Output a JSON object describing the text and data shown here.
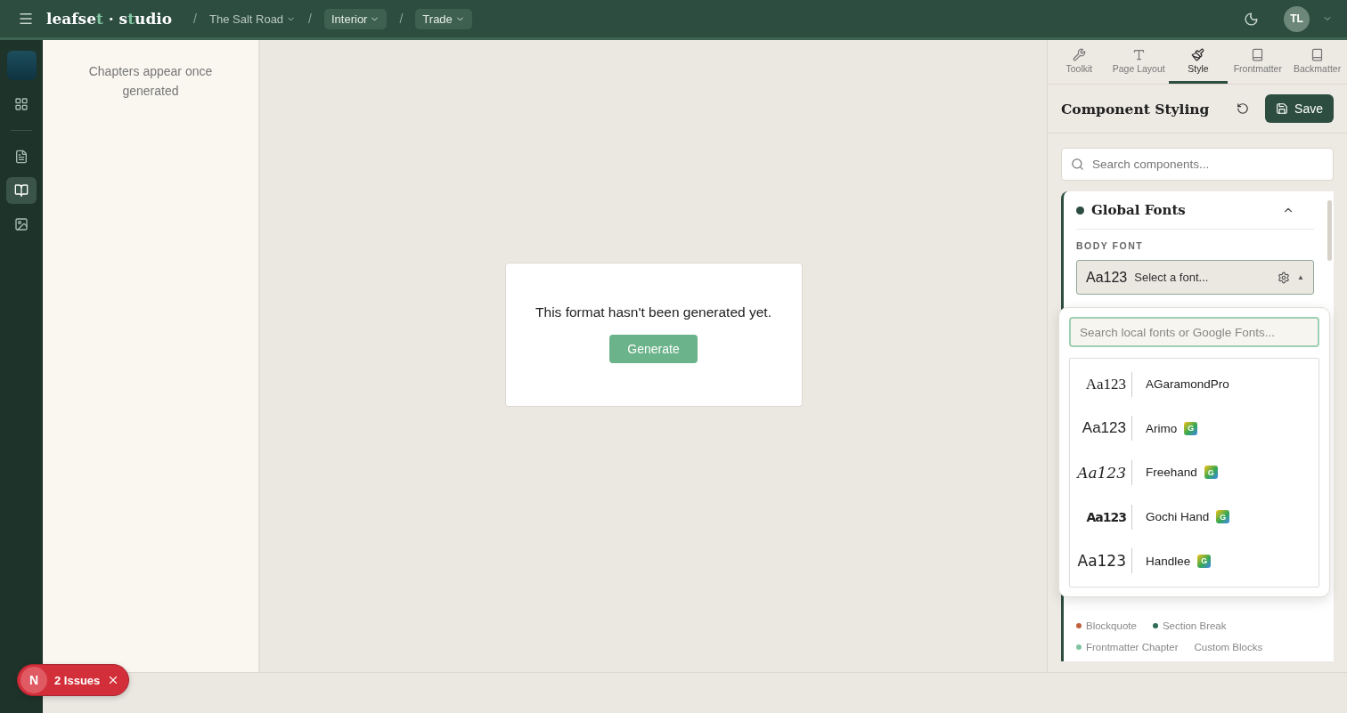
{
  "topbar": {
    "logo": [
      {
        "text": "leafse",
        "accent": false
      },
      {
        "text": "t",
        "accent": true
      },
      {
        "text": " · s",
        "accent": false
      },
      {
        "text": "t",
        "accent": true
      },
      {
        "text": "udio",
        "accent": false
      }
    ],
    "breadcrumbs": [
      {
        "label": "The Salt Road",
        "kind": "plain"
      },
      {
        "label": "Interior",
        "kind": "pill"
      },
      {
        "label": "Trade",
        "kind": "pill"
      }
    ],
    "separator": "/",
    "avatar": "TL"
  },
  "rail": [
    {
      "kind": "grid",
      "selected": false
    },
    {
      "kind": "file",
      "selected": false
    },
    {
      "kind": "book",
      "selected": true
    },
    {
      "kind": "image",
      "selected": false
    }
  ],
  "chapters": {
    "empty_text": "Chapters appear once generated"
  },
  "canvas": {
    "message": "This format hasn't been generated yet.",
    "button": "Generate"
  },
  "panel": {
    "tabs": [
      {
        "label": "Toolkit",
        "kind": "wrench",
        "selected": false
      },
      {
        "label": "Page Layout",
        "kind": "type",
        "selected": false
      },
      {
        "label": "Style",
        "kind": "brush",
        "selected": true
      },
      {
        "label": "Frontmatter",
        "kind": "book",
        "selected": false
      },
      {
        "label": "Backmatter",
        "kind": "book",
        "selected": false
      }
    ],
    "title": "Component Styling",
    "save": "Save",
    "search_placeholder": "Search components...",
    "section": {
      "title": "Global Fonts",
      "expanded": true,
      "field_label": "BODY FONT",
      "select_preview": "Aa123",
      "select_placeholder": "Select a font...",
      "caret": "▲",
      "open": true
    },
    "legend": [
      {
        "label": "Blockquote",
        "color": "#c0603f"
      },
      {
        "label": "Section Break",
        "color": "#2d6b55"
      },
      {
        "label": "Frontmatter Chapter",
        "color": "#7fc4a0"
      },
      {
        "label": "Custom Blocks"
      }
    ]
  },
  "font_menu": {
    "search_placeholder": "Search local fonts or Google Fonts...",
    "fonts": [
      {
        "name": "AGaramondPro",
        "preview": "Aa123",
        "kind": "serif"
      },
      {
        "name": "Arimo",
        "preview": "Aa123",
        "kind": "sans",
        "badge": "G"
      },
      {
        "name": "Freehand",
        "preview": "Aa123",
        "kind": "script",
        "badge": "G"
      },
      {
        "name": "Gochi Hand",
        "preview": "Aa123",
        "kind": "marker",
        "badge": "G"
      },
      {
        "name": "Handlee",
        "preview": "Aa123",
        "kind": "hand",
        "badge": "G"
      }
    ]
  },
  "issues": {
    "avatar": "N",
    "label": "2 Issues"
  }
}
